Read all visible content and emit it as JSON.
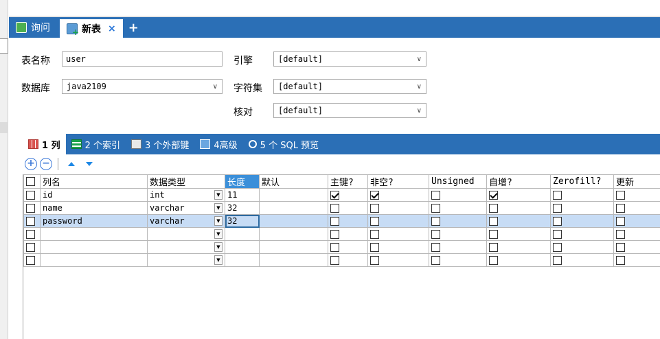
{
  "tabs": {
    "query_label": "询问",
    "new_table_label": "新表",
    "close_glyph": "×",
    "add_glyph": "+"
  },
  "form": {
    "table_name_label": "表名称",
    "table_name_value": "user",
    "database_label": "数据库",
    "database_value": "java2109",
    "engine_label": "引擎",
    "engine_value": "[default]",
    "charset_label": "字符集",
    "charset_value": "[default]",
    "collation_label": "核对",
    "collation_value": "[default]"
  },
  "subtabs": {
    "columns": "1 列",
    "indexes": "2 个索引",
    "foreign_keys": "3 个外部键",
    "advanced": "4高级",
    "sql_preview": "5 个 SQL 预览"
  },
  "toolbar": {
    "add": "+",
    "remove": "−"
  },
  "grid": {
    "headers": {
      "name": "列名",
      "type": "数据类型",
      "length": "长度",
      "default": "默认",
      "pk": "主键?",
      "notnull": "非空?",
      "unsigned": "Unsigned",
      "autoinc": "自增?",
      "zerofill": "Zerofill?",
      "update": "更新"
    },
    "rows": [
      {
        "name": "id",
        "type": "int",
        "length": "11",
        "pk": true,
        "notnull": true,
        "unsigned": false,
        "autoinc": true,
        "zerofill": false
      },
      {
        "name": "name",
        "type": "varchar",
        "length": "32",
        "pk": false,
        "notnull": false,
        "unsigned": false,
        "autoinc": false,
        "zerofill": false
      },
      {
        "name": "password",
        "type": "varchar",
        "length": "32",
        "pk": false,
        "notnull": false,
        "unsigned": false,
        "autoinc": false,
        "zerofill": false
      },
      {
        "name": "",
        "type": "",
        "length": "",
        "pk": false,
        "notnull": false,
        "unsigned": false,
        "autoinc": false,
        "zerofill": false
      },
      {
        "name": "",
        "type": "",
        "length": "",
        "pk": false,
        "notnull": false,
        "unsigned": false,
        "autoinc": false,
        "zerofill": false
      },
      {
        "name": "",
        "type": "",
        "length": "",
        "pk": false,
        "notnull": false,
        "unsigned": false,
        "autoinc": false,
        "zerofill": false
      }
    ]
  },
  "colors": {
    "accent": "#2b6fb6",
    "header_highlight": "#3b8fd9",
    "selected_row": "#c7dcf5"
  }
}
